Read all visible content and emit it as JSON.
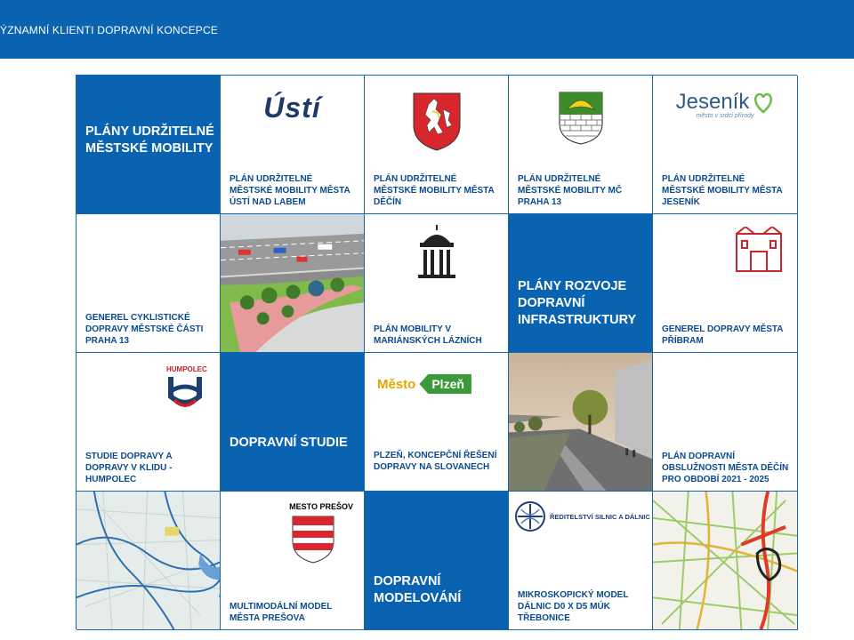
{
  "header": {
    "title": "ÝZNAMNÍ  KLIENTI DOPRAVNÍ KONCEPCE"
  },
  "colors": {
    "brand_blue": "#0a63b0",
    "text_blue": "#0a4a8c"
  },
  "cells": {
    "r1c1": {
      "title": "PLÁNY UDRŽITELNÉ MĚSTSKÉ MOBILITY"
    },
    "r1c2": {
      "logo": "Ústí",
      "caption": "PLÁN UDRŽITELNÉ MĚSTSKÉ MOBILITY MĚSTA ÚSTÍ NAD LABEM"
    },
    "r1c3": {
      "logo": "decin-coat-of-arms",
      "caption": "PLÁN UDRŽITELNÉ MĚSTSKÉ MOBILITY MĚSTA DĚČÍN"
    },
    "r1c4": {
      "logo": "praha13-coat-of-arms",
      "caption": "PLÁN UDRŽITELNÉ MĚSTSKÉ MOBILITY MČ PRAHA 13"
    },
    "r1c5": {
      "logo": "Jeseník",
      "logo_sub": "město v srdci přírody",
      "caption": "PLÁN UDRŽITELNÉ MĚSTSKÉ MOBILITY MĚSTA JESENÍK"
    },
    "r2c1": {
      "caption": "GENEREL CYKLISTICKÉ DOPRAVY MĚSTSKÉ ČÁSTI PRAHA 13"
    },
    "r2c2": {
      "image": "street-visualization"
    },
    "r2c3": {
      "logo": "colonnade-icon",
      "caption": "PLÁN MOBILITY V MARIÁNSKÝCH LÁZNÍCH"
    },
    "r2c4": {
      "title": "PLÁNY ROZVOJE DOPRAVNÍ INFRASTRUKTURY"
    },
    "r2c5": {
      "logo": "pribram-logo",
      "caption": "GENEREL DOPRAVY MĚSTA PŘÍBRAM"
    },
    "r3c1": {
      "logo_label": "HUMPOLEC",
      "caption": "STUDIE DOPRAVY A DOPRAVY V KLIDU - HUMPOLEC"
    },
    "r3c2": {
      "title": "DOPRAVNÍ STUDIE"
    },
    "r3c3": {
      "logo_left": "Město",
      "logo_right": "Plzeň",
      "caption": "PLZEŇ, KONCEPČNÍ ŘEŠENÍ DOPRAVY NA SLOVANECH"
    },
    "r3c4": {
      "image": "street-rendering"
    },
    "r3c5": {
      "caption": "PLÁN DOPRAVNÍ OBSLUŽNOSTI MĚSTA DĚČÍN PRO OBDOBÍ 2021 - 2025"
    },
    "r4c1": {
      "image": "city-map-blue"
    },
    "r4c2": {
      "logo_label": "MESTO PREŠOV",
      "caption": "MULTIMODÁLNÍ MODEL MĚSTA PREŠOVA"
    },
    "r4c3": {
      "title": "DOPRAVNÍ MODELOVÁNÍ"
    },
    "r4c4": {
      "logo_label": "ŘEDITELSTVÍ SILNIC A DÁLNIC ČR",
      "caption": "MIKROSKOPICKÝ MODEL DÁLNIC D0 X D5 MÚK TŘEBONICE"
    },
    "r4c5": {
      "image": "traffic-map"
    }
  }
}
